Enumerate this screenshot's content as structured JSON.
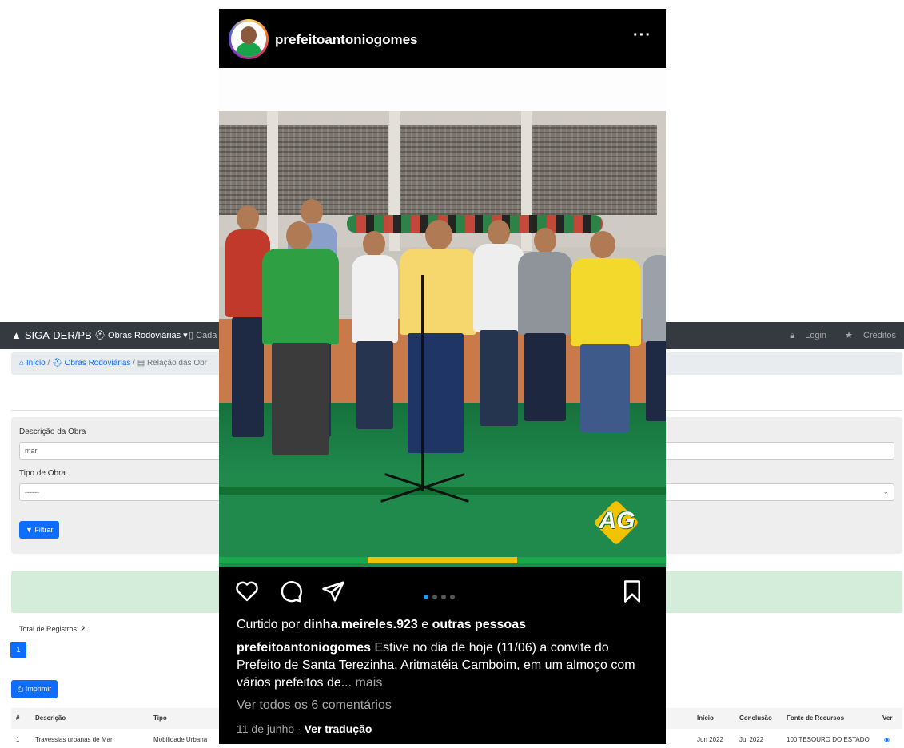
{
  "app": {
    "brand": "SIGA-DER/PB",
    "menu_obras": "Obras Rodoviárias ▾",
    "menu_cadastro": "Cada",
    "login": "Login",
    "creditos": "Créditos"
  },
  "breadcrumb": {
    "home": "Início",
    "obras": "Obras Rodoviárias",
    "relacao": "Relação das Obr"
  },
  "filter": {
    "descricao_label": "Descrição da Obra",
    "descricao_value": "mari",
    "tipo_label": "Tipo de Obra",
    "tipo_value": "------",
    "filtrar": "Filtrar"
  },
  "results": {
    "total_label": "Total de Registros:",
    "total_value": "2",
    "page": "1",
    "imprimir": "Imprimir"
  },
  "table": {
    "headers": {
      "num": "#",
      "descricao": "Descrição",
      "tipo": "Tipo",
      "inicio": "Início",
      "conclusao": "Conclusão",
      "fonte": "Fonte de Recursos",
      "ver": "Ver"
    },
    "rows": [
      {
        "num": "1",
        "descricao": "Travessias urbanas de Mari",
        "tipo": "Mobilidade Urbana",
        "inicio": "Jun 2022",
        "conclusao": "Jul 2022",
        "fonte": "100 TESOURO DO ESTADO"
      }
    ]
  },
  "instagram": {
    "username": "prefeitoantoniogomes",
    "likes_prefix": "Curtido por",
    "likes_user": "dinha.meireles.923",
    "likes_and": "e",
    "likes_others": "outras pessoas",
    "caption_user": "prefeitoantoniogomes",
    "caption_text": "Estive no dia de hoje (11/06) a convite do Prefeito de Santa Terezinha, Aritmatéia Camboim, em um almoço com vários prefeitos de...",
    "caption_more": "mais",
    "comments": "Ver todos os 6 comentários",
    "date": "11 de junho",
    "separator": "·",
    "translate": "Ver tradução",
    "logo_text": "AG"
  },
  "colors": {
    "navbar": "#343a40",
    "primary": "#0d6efd",
    "stage_green": "#1f8a4c",
    "stripe_green": "#1aa64a",
    "stripe_yellow": "#f2c200"
  }
}
